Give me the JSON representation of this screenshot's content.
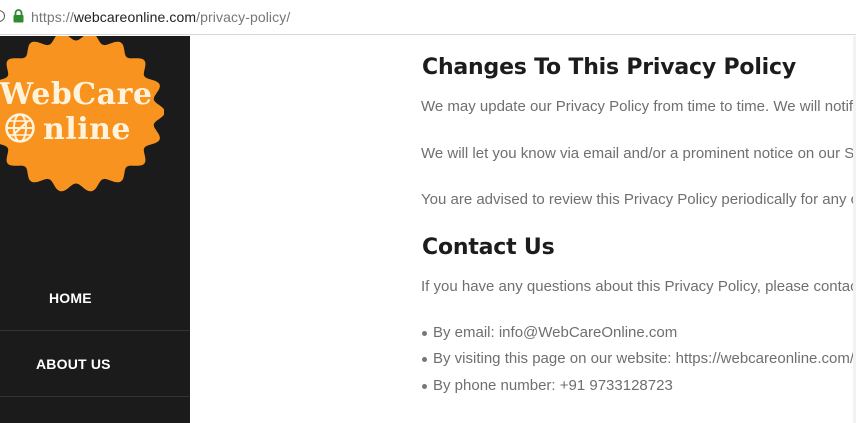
{
  "browser": {
    "url_prefix": "https://",
    "url_domain": "webcareonline.com",
    "url_path": "/privacy-policy/"
  },
  "logo": {
    "line1": "WebCare",
    "line2": "nline",
    "color": "#f7931e"
  },
  "sidebar": {
    "items": [
      {
        "label": "HOME"
      },
      {
        "label": "ABOUT US"
      }
    ]
  },
  "main": {
    "changes_heading": "Changes To This Privacy Policy",
    "changes_p1": "We may update our Privacy Policy from time to time. We will notify y",
    "changes_p2": "We will let you know via email and/or a prominent notice on our Se",
    "changes_p3": "You are advised to review this Privacy Policy periodically for any cha",
    "contact_heading": "Contact Us",
    "contact_p": "If you have any questions about this Privacy Policy, please contact u",
    "contact_list": [
      "By email: info@WebCareOnline.com",
      "By visiting this page on our website: https://webcareonline.com/c",
      "By phone number: +91 9733128723"
    ]
  }
}
